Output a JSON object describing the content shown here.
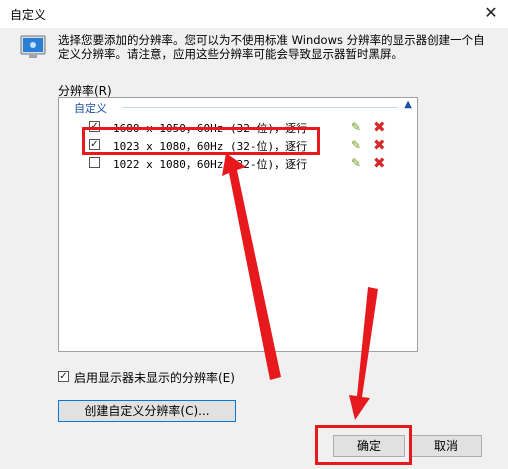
{
  "window": {
    "title": "自定义",
    "close_glyph": "✕"
  },
  "description": "选择您要添加的分辨率。您可以为不使用标准 Windows 分辨率的显示器创建一个自定义分辨率。请注意，应用这些分辨率可能会导致显示器暂时黑屏。",
  "resolutions": {
    "group_label": "分辨率(R)",
    "section_label": "自定义",
    "items": [
      {
        "text": "1680 x 1050，60Hz (32-位)，逐行",
        "checked": true
      },
      {
        "text": "1023 x 1080，60Hz (32-位)，逐行",
        "checked": true
      },
      {
        "text": "1022 x 1080，60Hz (32-位)，逐行",
        "checked": false
      }
    ]
  },
  "option": {
    "label": "启用显示器未显示的分辨率(E)",
    "checked": true
  },
  "buttons": {
    "create": "创建自定义分辨率(C)...",
    "ok": "确定",
    "cancel": "取消"
  },
  "colors": {
    "annotation_red": "#e8191c",
    "section_blue": "#1e4fa8"
  }
}
